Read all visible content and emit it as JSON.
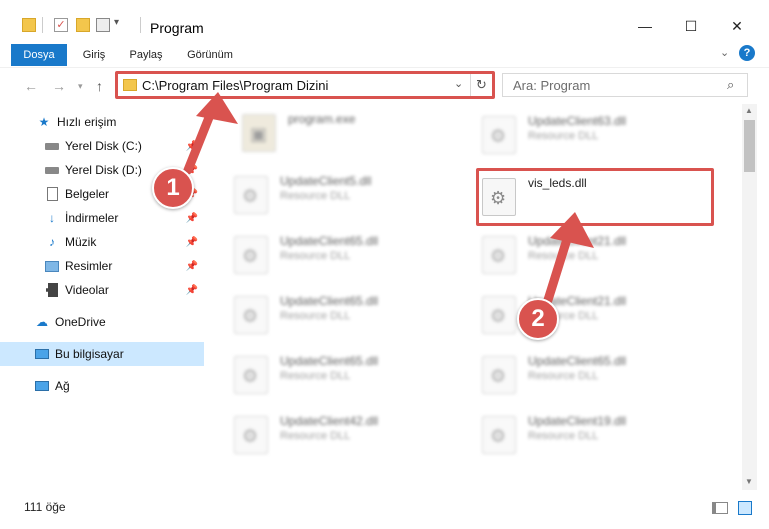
{
  "window": {
    "title": "Program",
    "minimize": "—",
    "maximize": "☐",
    "close": "✕"
  },
  "ribbon": {
    "tabs": [
      "Dosya",
      "Giriş",
      "Paylaş",
      "Görünüm"
    ],
    "help_icon": "?"
  },
  "address": {
    "path": "C:\\Program Files\\Program Dizini",
    "search_placeholder": "Ara: Program"
  },
  "sidebar": {
    "items": [
      {
        "label": "Hızlı erişim",
        "icon": "star-icon"
      },
      {
        "label": "Yerel Disk (C:)",
        "icon": "drive-icon",
        "pinned": true
      },
      {
        "label": "Yerel Disk (D:)",
        "icon": "drive-icon",
        "pinned": true
      },
      {
        "label": "Belgeler",
        "icon": "documents-icon",
        "pinned": true
      },
      {
        "label": "İndirmeler",
        "icon": "download-icon",
        "pinned": true
      },
      {
        "label": "Müzik",
        "icon": "music-icon",
        "pinned": true
      },
      {
        "label": "Resimler",
        "icon": "pictures-icon",
        "pinned": true
      },
      {
        "label": "Videolar",
        "icon": "video-icon",
        "pinned": true
      },
      {
        "label": "OneDrive",
        "icon": "cloud-icon"
      },
      {
        "label": "Bu bilgisayar",
        "icon": "computer-icon",
        "selected": true
      },
      {
        "label": "Ağ",
        "icon": "network-icon"
      }
    ]
  },
  "files": {
    "left": [
      {
        "name": "program.exe",
        "type": ""
      },
      {
        "name": "UpdateClient5.dll",
        "type": "Resource DLL"
      },
      {
        "name": "UpdateClient65.dll",
        "type": "Resource DLL"
      },
      {
        "name": "UpdateClient65.dll",
        "type": "Resource DLL"
      },
      {
        "name": "UpdateClient65.dll",
        "type": "Resource DLL"
      },
      {
        "name": "UpdateClient42.dll",
        "type": "Resource DLL"
      }
    ],
    "right": [
      {
        "name": "UpdateClient63.dll",
        "type": "Resource DLL"
      },
      {
        "name": "vis_leds.dll",
        "type": ""
      },
      {
        "name": "UpdateClient21.dll",
        "type": "Resource DLL"
      },
      {
        "name": "UpdateClient21.dll",
        "type": "Resource DLL"
      },
      {
        "name": "UpdateClient65.dll",
        "type": "Resource DLL"
      },
      {
        "name": "UpdateClient19.dll",
        "type": "Resource DLL"
      }
    ]
  },
  "status": {
    "count": "111 öğe"
  },
  "annotations": {
    "callout_1": "1",
    "callout_2": "2",
    "color": "#d9534f"
  }
}
